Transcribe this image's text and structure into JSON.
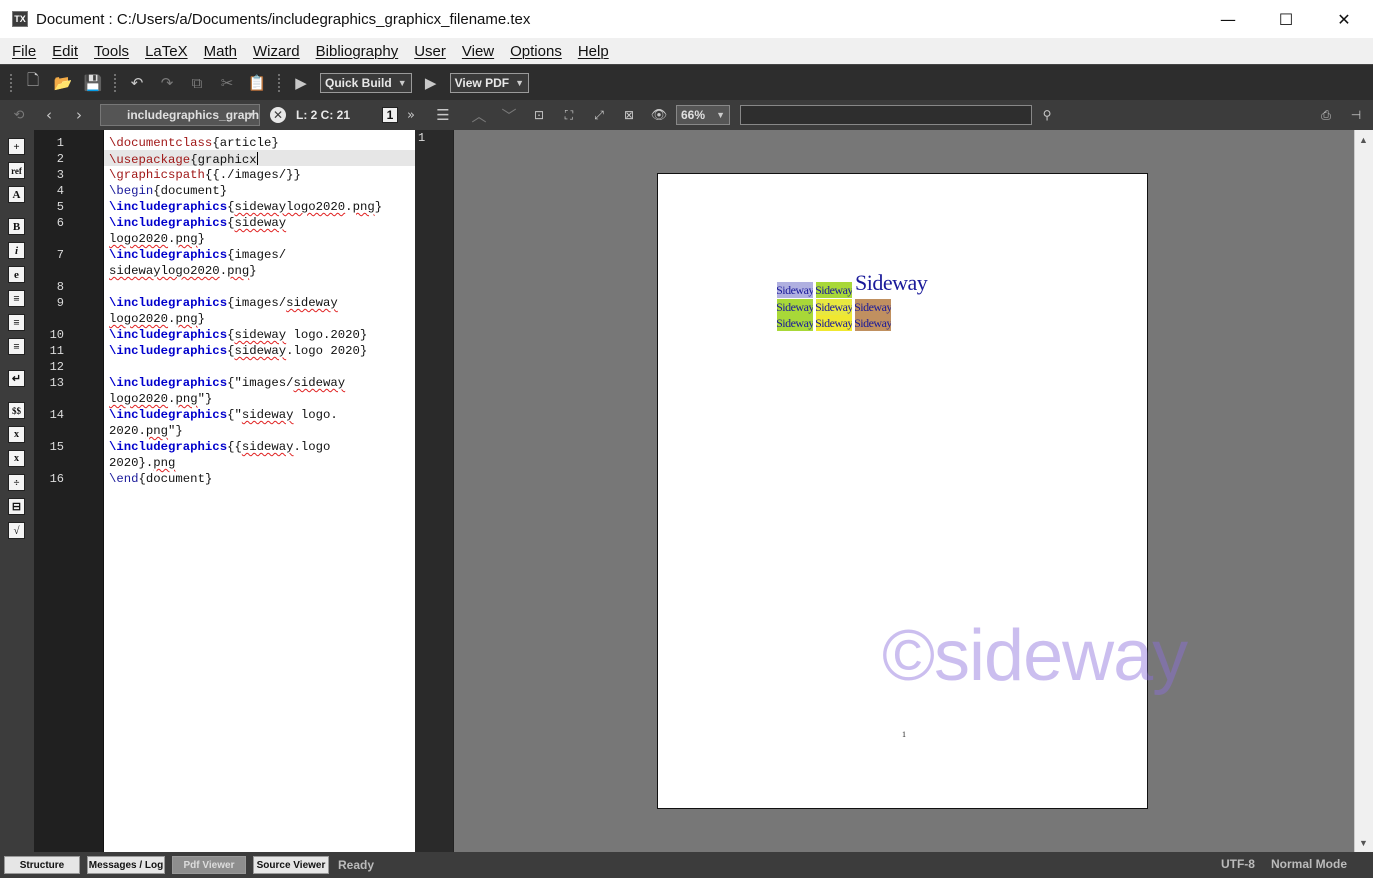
{
  "window": {
    "title": "Document : C:/Users/a/Documents/includegraphics_graphicx_filename.tex",
    "app_icon_label": "TX",
    "minimize": "—",
    "maximize": "☐",
    "close": "✕"
  },
  "menu": {
    "items": [
      "File",
      "Edit",
      "Tools",
      "LaTeX",
      "Math",
      "Wizard",
      "Bibliography",
      "User",
      "View",
      "Options",
      "Help"
    ]
  },
  "toolbar": {
    "quick_build": "Quick Build",
    "view_pdf": "View PDF"
  },
  "editor_bar": {
    "tab_name": "includegraphics_graphicx_filename.tex",
    "line_col": "L: 2 C: 21",
    "page_number": "1",
    "zoom": "66%",
    "search_placeholder": ""
  },
  "gutter": {
    "line_numbers": [
      "1",
      "2",
      "3",
      "4",
      "5",
      "6",
      "7",
      "8",
      "9",
      "10",
      "11",
      "12",
      "13",
      "14",
      "15",
      "16"
    ]
  },
  "code": {
    "l1_cmd": "\\documentclass",
    "l1_rest": "{article}",
    "l2_cmd": "\\usepackage",
    "l2_rest": "{graphicx",
    "l3_cmd": "\\graphicspath",
    "l3_rest": "{{./images/}}",
    "l4_cmd": "\\begin",
    "l4_rest": "{document}",
    "ig": "\\includegraphics",
    "l5_a": "{",
    "l5_b": "sidewaylogo2020",
    "l5_c": ".",
    "l5_d": "png",
    "l5_e": "}",
    "l6_a": "{",
    "l6_b": "sideway",
    "l6w_a": "logo2020",
    "l6w_b": ".",
    "l6w_c": "png",
    "l6w_d": "}",
    "l7_a": "{images/",
    "l7w_a": "sidewaylogo2020",
    "l7w_b": ".",
    "l7w_c": "png",
    "l7w_d": "}",
    "l9_a": "{images/",
    "l9_b": "sideway",
    "l9w_a": "logo2020",
    "l9w_b": ".",
    "l9w_c": "png",
    "l9w_d": "}",
    "l10_a": "{",
    "l10_b": "sideway",
    "l10_c": " logo.2020}",
    "l11_a": "{",
    "l11_b": "sideway",
    "l11_c": ".logo 2020}",
    "l13_a": "{\"images/",
    "l13_b": "sideway",
    "l13w_a": "logo2020",
    "l13w_b": ".",
    "l13w_c": "png",
    "l13w_d": "\"}",
    "l14_a": "{\"",
    "l14_b": "sideway",
    "l14_c": " logo.",
    "l14w_a": "2020.",
    "l14w_b": "png",
    "l14w_c": "\"}",
    "l15_a": "{{",
    "l15_b": "sideway",
    "l15_c": ".logo",
    "l15w_a": "2020}.",
    "l15w_b": "png",
    "l16_cmd": "\\end",
    "l16_rest": "{document}"
  },
  "pdf": {
    "gutter_label": "1",
    "logo_small": "Sideway",
    "logo_big": "Sideway",
    "page_footer": "1",
    "watermark": "©sideway"
  },
  "colors": {
    "logo_cells": [
      "#b0b0e0",
      "#a8d838",
      "#a8d838",
      "#e8e840",
      "#a8d838",
      "#f0e830",
      "#c09060",
      "#a8d838",
      "#e8e840",
      "#c09060"
    ]
  },
  "statusbar": {
    "structure": "Structure",
    "messages": "Messages / Log",
    "pdf_viewer": "Pdf Viewer",
    "source_viewer": "Source Viewer",
    "status": "Ready",
    "encoding": "UTF-8",
    "mode": "Normal Mode"
  }
}
